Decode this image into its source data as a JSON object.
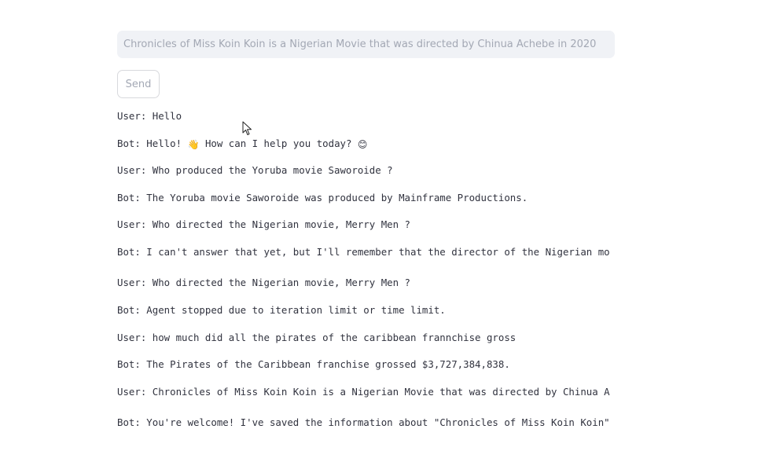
{
  "input": {
    "placeholder": "Chronicles of Miss Koin Koin is a Nigerian Movie that was directed by Chinua Achebe in 2020",
    "value": ""
  },
  "send_button": {
    "label": "Send"
  },
  "messages": [
    {
      "text": "User: Hello"
    },
    {
      "text": "Bot: Hello!",
      "emoji1": "👋",
      "text2": " How can I help you today?",
      "emoji2": "😊"
    },
    {
      "text": "User: Who produced the Yoruba movie Saworoide ?"
    },
    {
      "text": "Bot: The Yoruba movie Saworoide was produced by Mainframe Productions."
    },
    {
      "text": "User: Who directed the Nigerian movie, Merry Men ?"
    },
    {
      "text": "Bot: I can't answer that yet, but I'll remember that the director of the Nigerian mo"
    },
    {
      "text": "User: Who directed the Nigerian movie, Merry Men ?"
    },
    {
      "text": "Bot: Agent stopped due to iteration limit or time limit."
    },
    {
      "text": "User: how much did all the pirates of the caribbean frannchise gross"
    },
    {
      "text": "Bot: The Pirates of the Caribbean franchise grossed $3,727,384,838."
    },
    {
      "text": "User: Chronicles of Miss Koin Koin is a Nigerian Movie that was directed by Chinua A"
    },
    {
      "text": "Bot: You're welcome! I've saved the information about \"Chronicles of Miss Koin Koin\""
    }
  ]
}
